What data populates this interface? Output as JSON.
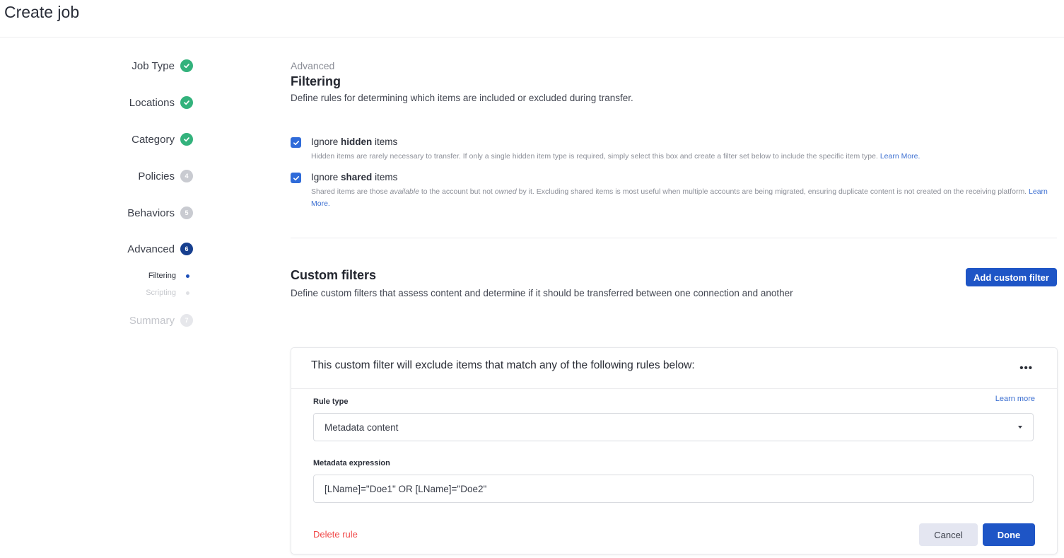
{
  "page": {
    "title": "Create job"
  },
  "colors": {
    "accent": "#1e55c6",
    "success": "#33b27c",
    "current_step": "#173f8f",
    "danger": "#f04848",
    "link": "#3c6fd1"
  },
  "sidebar": {
    "steps": [
      {
        "label": "Job Type",
        "status": "completed",
        "icon": "check-circle-icon",
        "badge": ""
      },
      {
        "label": "Locations",
        "status": "completed",
        "icon": "check-circle-icon",
        "badge": ""
      },
      {
        "label": "Category",
        "status": "completed",
        "icon": "check-circle-icon",
        "badge": ""
      },
      {
        "label": "Policies",
        "status": "pending",
        "badge": "4"
      },
      {
        "label": "Behaviors",
        "status": "pending",
        "badge": "5"
      },
      {
        "label": "Advanced",
        "status": "current",
        "badge": "6"
      },
      {
        "label": "Summary",
        "status": "upcoming",
        "badge": "7"
      }
    ],
    "substeps": [
      {
        "label": "Filtering",
        "status": "current"
      },
      {
        "label": "Scripting",
        "status": "upcoming"
      }
    ]
  },
  "main": {
    "breadcrumb": "Advanced",
    "title": "Filtering",
    "description": "Define rules for determining which items are included or excluded during transfer.",
    "options": [
      {
        "checked": true,
        "title_pre": "Ignore ",
        "title_bold": "hidden",
        "title_post": " items",
        "desc": "Hidden items are rarely necessary to transfer. If only a single hidden item type is required, simply select this box and create a filter set below to include the specific item type. ",
        "link": "Learn More."
      },
      {
        "checked": true,
        "title_pre": "Ignore ",
        "title_bold": "shared",
        "title_post": " items",
        "desc_1": "Shared items are those ",
        "desc_em1": "available",
        "desc_2": " to the account but not ",
        "desc_em2": "owned",
        "desc_3": " by it. Excluding shared items is most useful when multiple accounts are being migrated, ensuring duplicate content is not created on the receiving platform. ",
        "link": "Learn More."
      }
    ],
    "custom_filters": {
      "title": "Custom filters",
      "description": "Define custom filters that assess content and determine if it should be transferred between one connection and another",
      "add_button": "Add custom filter",
      "card": {
        "heading": "This custom filter will exclude items that match any of the following rules below:",
        "menu_icon": "more-horizontal-icon",
        "rule_type_label": "Rule type",
        "learn_more": "Learn more",
        "rule_type_value": "Metadata content",
        "expression_label": "Metadata expression",
        "expression_value": "[LName]=\"Doe1\" OR [LName]=\"Doe2\"",
        "delete_label": "Delete rule",
        "cancel_label": "Cancel",
        "done_label": "Done"
      }
    }
  }
}
